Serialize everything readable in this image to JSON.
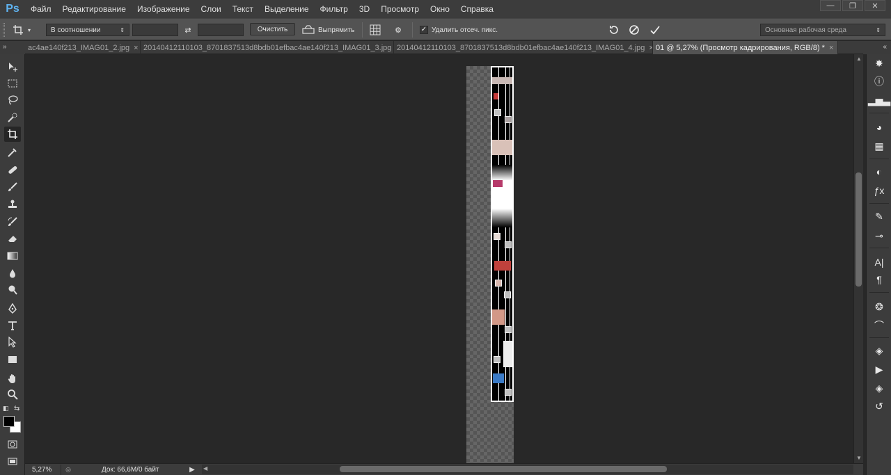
{
  "app": {
    "logo": "Ps"
  },
  "menu": [
    "Файл",
    "Редактирование",
    "Изображение",
    "Слои",
    "Текст",
    "Выделение",
    "Фильтр",
    "3D",
    "Просмотр",
    "Окно",
    "Справка"
  ],
  "window_controls": {
    "minimize": "—",
    "restore": "❐",
    "close": "✕"
  },
  "options_bar": {
    "ratio_select": "В соотношении",
    "clear_button": "Очистить",
    "straighten_label": "Выпрямить",
    "delete_cropped_label": "Удалить отсеч. пикс.",
    "delete_cropped_checked": true,
    "workspace_select": "Основная рабочая среда"
  },
  "tabs": [
    {
      "label": "ac4ae140f213_IMAG01_2.jpg",
      "active": false
    },
    {
      "label": "20140412110103_8701837513d8bdb01efbac4ae140f213_IMAG01_3.jpg",
      "active": false
    },
    {
      "label": "20140412110103_8701837513d8bdb01efbac4ae140f213_IMAG01_4.jpg",
      "active": false
    },
    {
      "label": "01 @ 5,27% (Просмотр кадрирования, RGB/8) *",
      "active": true
    }
  ],
  "status": {
    "zoom": "5,27%",
    "doc_info": "Док: 66,6M/0 байт"
  },
  "colors": {
    "foreground": "#000000",
    "background": "#ffffff",
    "accent": "#5fb3f0"
  }
}
